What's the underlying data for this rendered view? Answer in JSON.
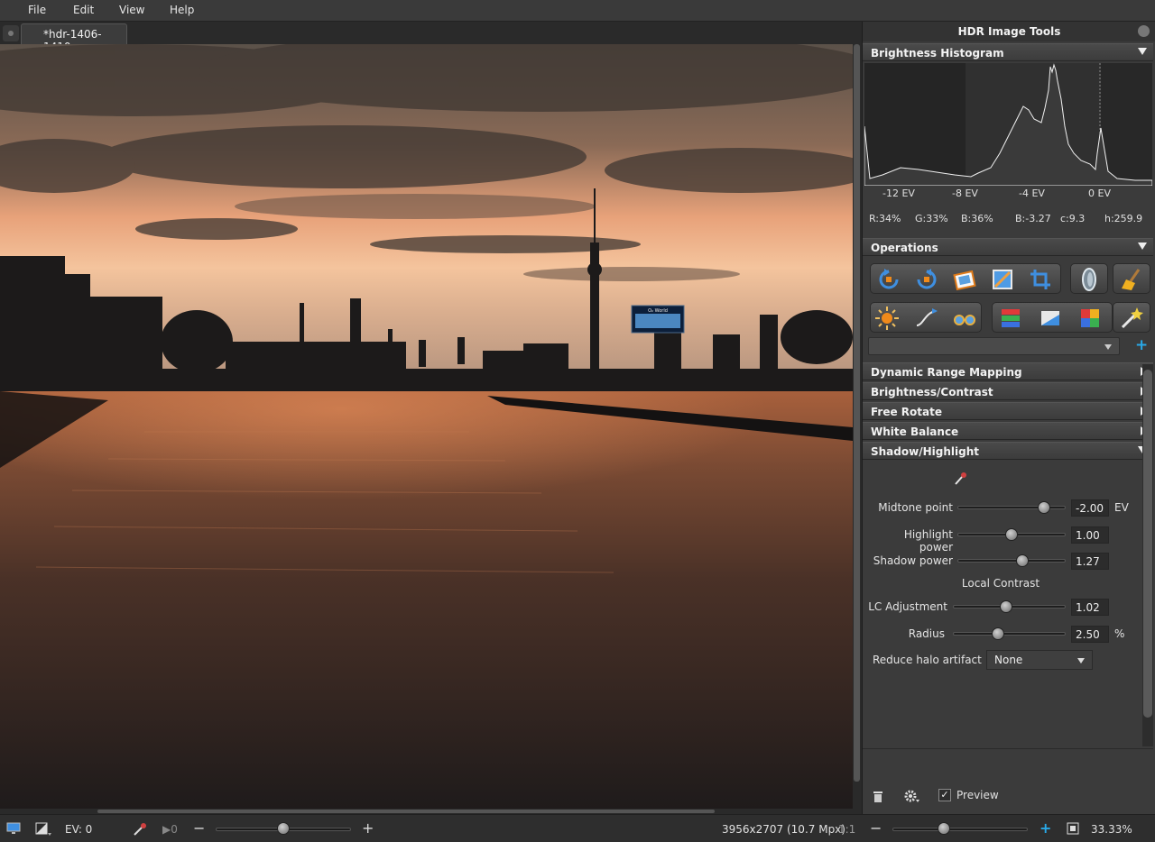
{
  "menu": {
    "items": [
      "File",
      "Edit",
      "View",
      "Help"
    ]
  },
  "document_tab": {
    "label": "*hdr-1406-1410"
  },
  "image": {
    "billboard_text": "O₂ World"
  },
  "panel": {
    "title": "HDR Image Tools",
    "histogram": {
      "header": "Brightness Histogram",
      "ticks": [
        "-12 EV",
        "-8 EV",
        "-4 EV",
        "0 EV"
      ],
      "stats": {
        "r": "R:34%",
        "g": "G:33%",
        "b": "B:36%",
        "brightness": "B:-3.27",
        "c": "c:9.3",
        "h": "h:259.9"
      }
    },
    "operations": {
      "header": "Operations",
      "combo_value": "",
      "add_label": "+"
    },
    "sections": [
      {
        "label": "Dynamic Range Mapping",
        "expanded": false
      },
      {
        "label": "Brightness/Contrast",
        "expanded": false
      },
      {
        "label": "Free Rotate",
        "expanded": false
      },
      {
        "label": "White Balance",
        "expanded": false
      },
      {
        "label": "Shadow/Highlight",
        "expanded": true
      }
    ],
    "shadow_highlight": {
      "midtone": {
        "label": "Midtone point",
        "value": "-2.00",
        "unit": "EV",
        "level": 0.8
      },
      "highlight": {
        "label": "Highlight power",
        "value": "1.00",
        "level": 0.5
      },
      "shadow": {
        "label": "Shadow power",
        "value": "1.27",
        "level": 0.6
      },
      "local_contrast_heading": "Local Contrast",
      "lc": {
        "label": "LC Adjustment",
        "value": "1.02",
        "level": 0.47
      },
      "radius": {
        "label": "Radius",
        "value": "2.50",
        "unit": "%",
        "level": 0.4
      },
      "halo": {
        "label": "Reduce halo artifact",
        "value": "None"
      }
    },
    "footer": {
      "preview_label": "Preview",
      "preview_checked": true
    }
  },
  "statusbar": {
    "ev_label": "EV: 0",
    "play_label": "▶0",
    "exposure_level": 0.5,
    "dimensions": "3956x2707 (10.7 Mpx)",
    "ratio": "1:1",
    "zoom_level": 0.38,
    "zoom": "33.33%"
  },
  "colors": {
    "accent_blue": "#29a9e8",
    "panel_bg": "#3b3b3b"
  }
}
